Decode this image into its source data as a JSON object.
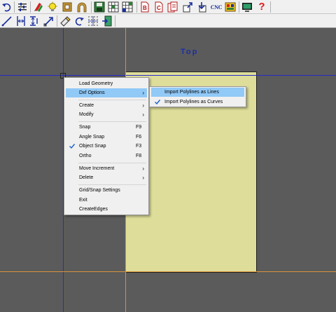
{
  "toolbar_top": {
    "buttons": [
      {
        "name": "undo-icon"
      },
      {
        "name": "settings-list-icon"
      },
      {
        "name": "color-pens-icon"
      },
      {
        "name": "light-bulb-icon"
      },
      {
        "name": "frame-icon"
      },
      {
        "name": "arch-icon"
      },
      {
        "name": "save-icon"
      },
      {
        "name": "grid-view-icon"
      },
      {
        "name": "save-grid-icon"
      },
      {
        "name": "document-b-icon"
      },
      {
        "name": "document-c-icon"
      },
      {
        "name": "document-copy-icon"
      },
      {
        "name": "export-icon"
      },
      {
        "name": "import-icon"
      },
      {
        "name": "cnc-icon"
      },
      {
        "name": "toolpath-icon"
      },
      {
        "name": "monitor-icon"
      },
      {
        "name": "help-icon"
      }
    ],
    "cnc_label": "CNC",
    "help_glyph": "?"
  },
  "toolbar_bottom": {
    "buttons": [
      {
        "name": "line-tool-icon"
      },
      {
        "name": "vertical-dimension-icon"
      },
      {
        "name": "horizontal-dimension-icon"
      },
      {
        "name": "arrow-point-icon"
      },
      {
        "name": "eraser-icon"
      },
      {
        "name": "redo-icon"
      },
      {
        "name": "snap-grid-icon"
      },
      {
        "name": "exit-door-icon"
      }
    ]
  },
  "canvas": {
    "view_title": "Top",
    "colors": {
      "background": "#5b5b5b",
      "sheet": "#dede9a",
      "guide_blue": "#2a2ac8",
      "guide_orange": "#d8923a"
    }
  },
  "context_menu": {
    "items": [
      {
        "label": "Load Geometry",
        "key": "",
        "submenu": false,
        "checked": false
      },
      {
        "label": "Dxf Options",
        "key": "",
        "submenu": true,
        "checked": false,
        "highlighted": true
      },
      {
        "label": "Create",
        "key": "",
        "submenu": true,
        "checked": false
      },
      {
        "label": "Modify",
        "key": "",
        "submenu": true,
        "checked": false
      },
      {
        "label": "Snap",
        "key": "F9",
        "submenu": false,
        "checked": false
      },
      {
        "label": "Angle Snap",
        "key": "F6",
        "submenu": false,
        "checked": false
      },
      {
        "label": "Object Snap",
        "key": "F3",
        "submenu": false,
        "checked": true
      },
      {
        "label": "Ortho",
        "key": "F8",
        "submenu": false,
        "checked": false
      },
      {
        "label": "Move Increment",
        "key": "",
        "submenu": true,
        "checked": false
      },
      {
        "label": "Delete",
        "key": "",
        "submenu": true,
        "checked": false
      },
      {
        "label": "Grid/Snap Settings",
        "key": "",
        "submenu": false,
        "checked": false
      },
      {
        "label": "Exit",
        "key": "",
        "submenu": false,
        "checked": false
      },
      {
        "label": "CreateEdges",
        "key": "",
        "submenu": false,
        "checked": false
      }
    ],
    "arrow_glyph": "›"
  },
  "submenu": {
    "items": [
      {
        "label": "Import Polylines as Lines",
        "checked": false,
        "highlighted": true
      },
      {
        "label": "Import Polylines as Curves",
        "checked": true,
        "highlighted": false
      }
    ]
  },
  "highlight_color": "#91c9f7"
}
